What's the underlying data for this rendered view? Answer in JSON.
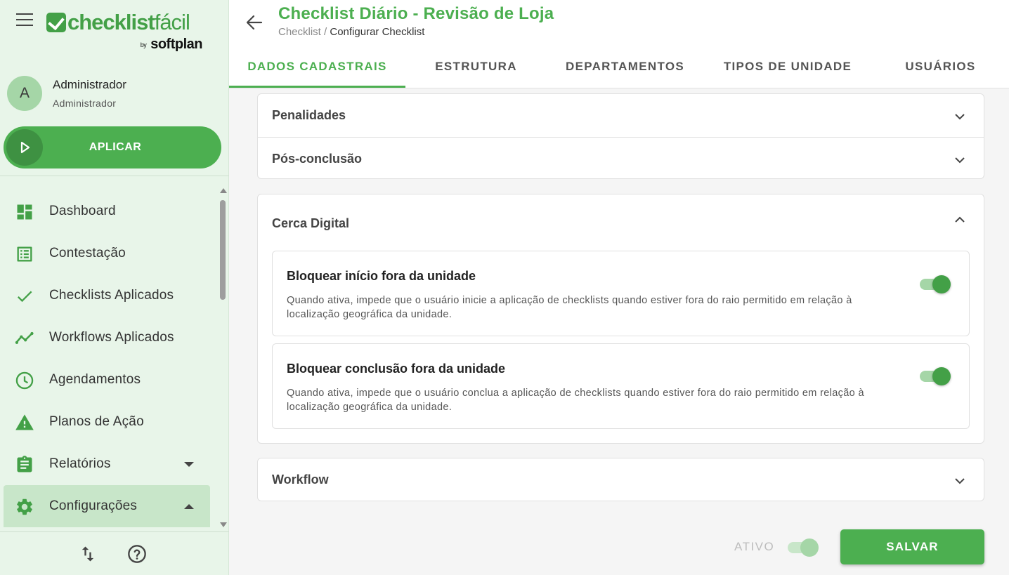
{
  "brand": {
    "name_bold": "checklist",
    "name_thin": "fácil",
    "by": "by",
    "company": "softplan"
  },
  "user": {
    "initial": "A",
    "name": "Administrador",
    "role": "Administrador"
  },
  "sidebar": {
    "apply_label": "APLICAR",
    "items": [
      {
        "label": "Dashboard",
        "icon": "dashboard-icon"
      },
      {
        "label": "Contestação",
        "icon": "list-alt-icon"
      },
      {
        "label": "Checklists Aplicados",
        "icon": "check-icon"
      },
      {
        "label": "Workflows Aplicados",
        "icon": "timeline-icon"
      },
      {
        "label": "Agendamentos",
        "icon": "clock-icon"
      },
      {
        "label": "Planos de Ação",
        "icon": "warning-icon"
      },
      {
        "label": "Relatórios",
        "icon": "clipboard-icon",
        "expandable": true,
        "expanded": false
      },
      {
        "label": "Configurações",
        "icon": "gear-icon",
        "expandable": true,
        "expanded": true,
        "active": true
      }
    ],
    "footer_icons": [
      "swap-vert-icon",
      "help-icon"
    ]
  },
  "header": {
    "title": "Checklist Diário - Revisão de Loja",
    "breadcrumb": {
      "parent": "Checklist",
      "separator": "/",
      "current": "Configurar Checklist"
    },
    "tabs": [
      {
        "label": "DADOS CADASTRAIS",
        "active": true
      },
      {
        "label": "ESTRUTURA"
      },
      {
        "label": "DEPARTAMENTOS"
      },
      {
        "label": "TIPOS DE UNIDADE"
      },
      {
        "label": "USUÁRIOS"
      }
    ]
  },
  "content": {
    "sections_top": [
      {
        "title": "Penalidades",
        "expanded": false
      },
      {
        "title": "Pós-conclusão",
        "expanded": false
      }
    ],
    "geofence": {
      "title": "Cerca Digital",
      "expanded": true,
      "options": [
        {
          "title": "Bloquear início fora da unidade",
          "description": "Quando ativa, impede que o usuário inicie a aplicação de checklists quando estiver fora do raio permitido em relação à localização geográfica da unidade.",
          "enabled": true
        },
        {
          "title": "Bloquear conclusão fora da unidade",
          "description": "Quando ativa, impede que o usuário conclua a aplicação de checklists quando estiver fora do raio permitido em relação à localização geográfica da unidade.",
          "enabled": true
        }
      ]
    },
    "workflow": {
      "title": "Workflow",
      "expanded": false
    }
  },
  "footer": {
    "status_label": "ATIVO",
    "status_enabled": true,
    "save_label": "SALVAR"
  },
  "colors": {
    "primary": "#4caf50",
    "sidebar_bg": "#e8f5e9",
    "active_item_bg": "#c8e6c9"
  }
}
